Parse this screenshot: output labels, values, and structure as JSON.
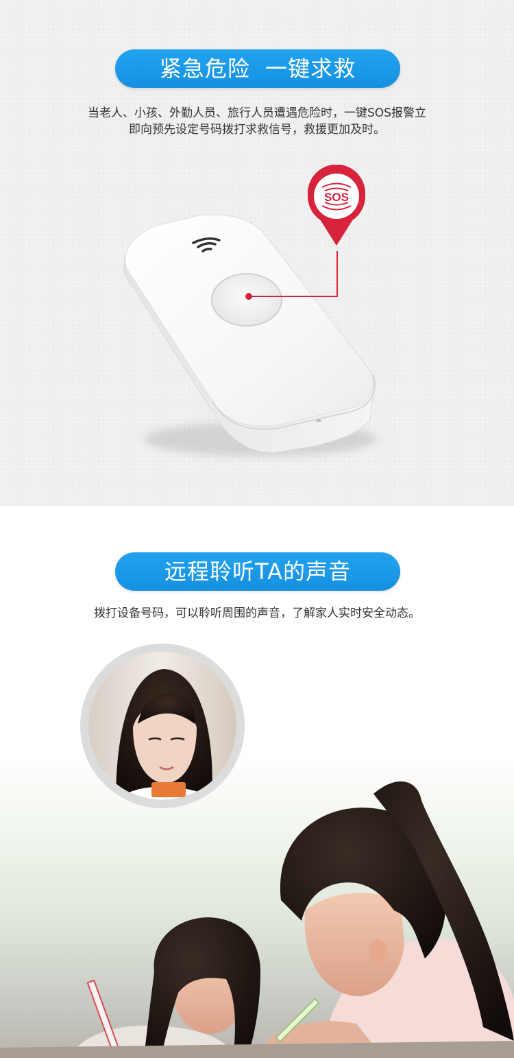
{
  "section1": {
    "title": "紧急危险  一键求救",
    "desc_line1": "当老人、小孩、外勤人员、旅行人员遭遇危险时，一键SOS报警立",
    "desc_line2": "即向预先设定号码拨打求救信号，救援更加及时。",
    "sos_label": "SOS",
    "accent": "#d7233c",
    "pill_color": "#1a98e6"
  },
  "section2": {
    "title": "远程聆听TA的声音",
    "desc": "拨打设备号码，可以聆听周围的声音，了解家人实时安全动态。"
  }
}
